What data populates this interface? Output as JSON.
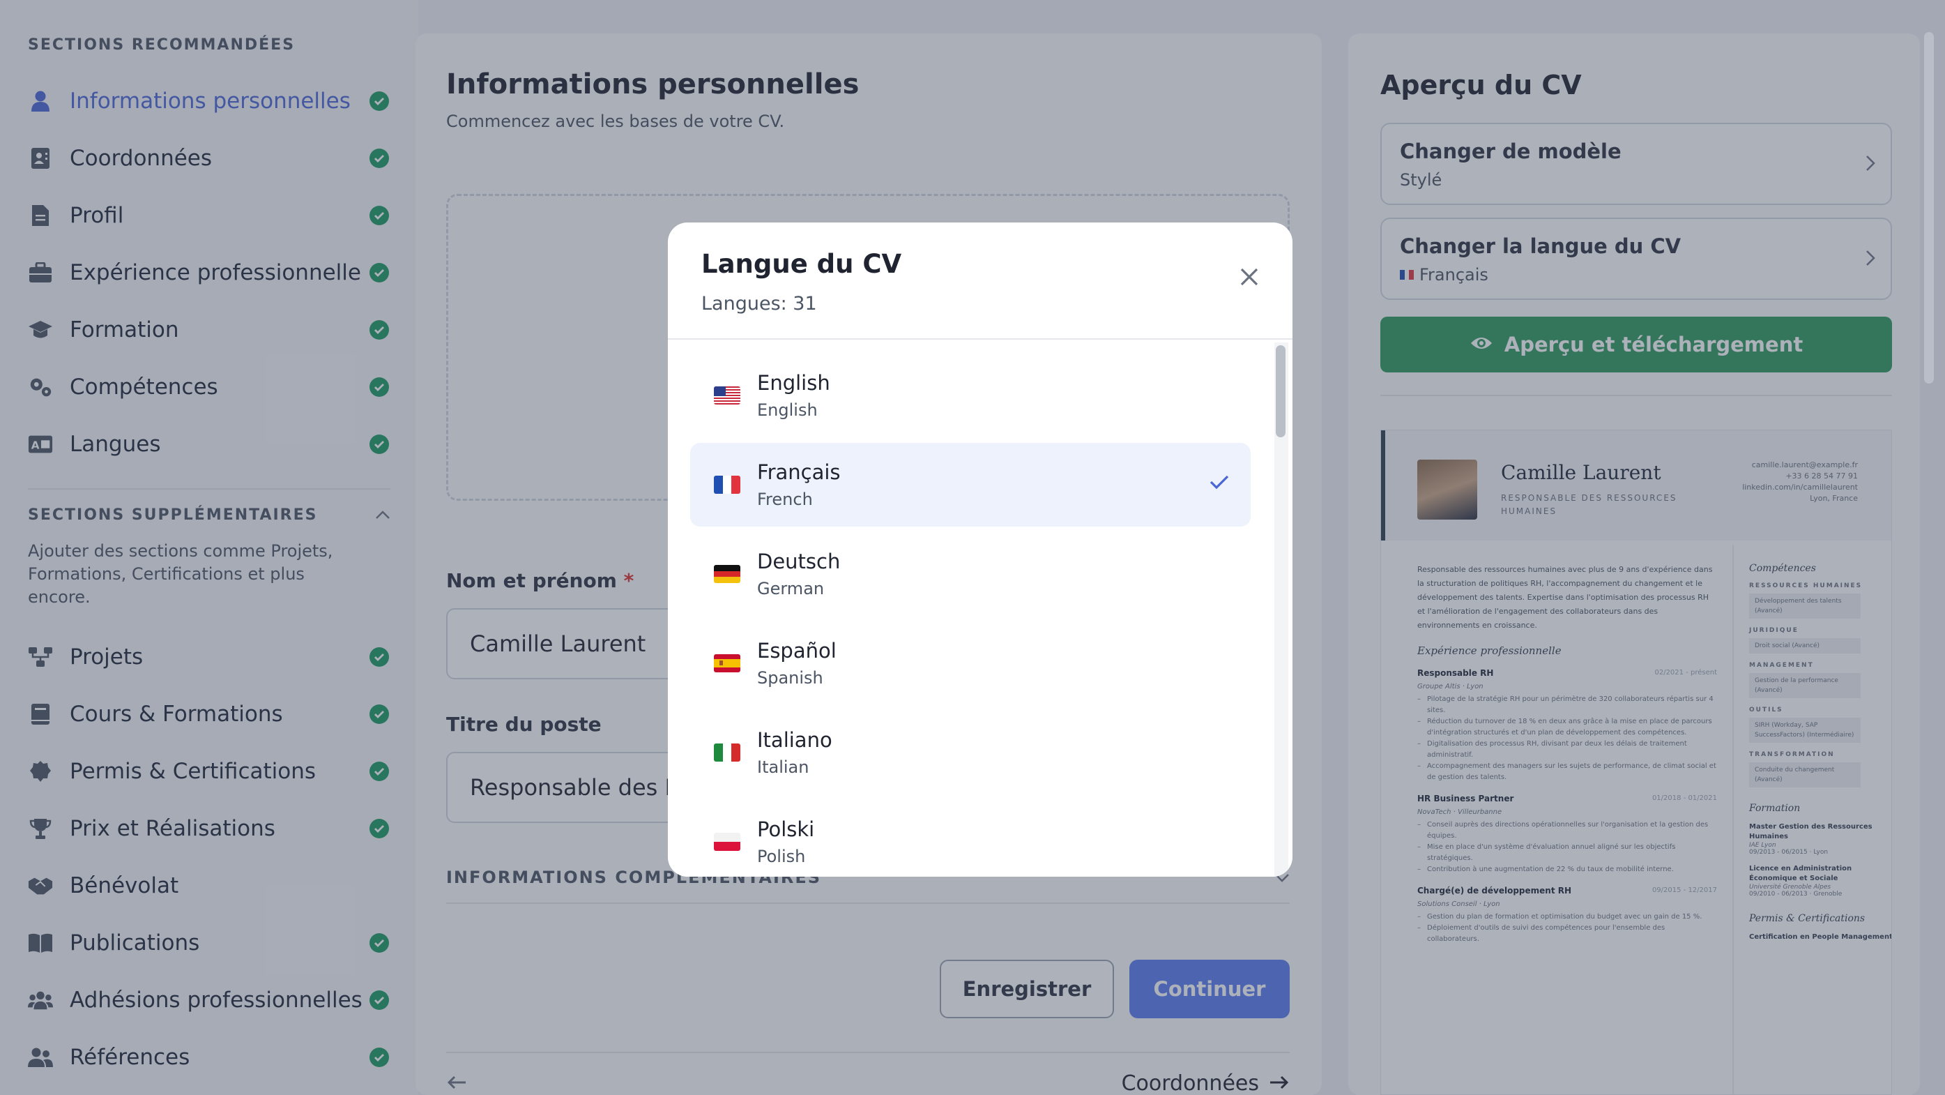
{
  "sidebar": {
    "recommended_heading": "SECTIONS RECOMMANDÉES",
    "recommended": [
      {
        "label": "Informations personnelles",
        "icon": "user-icon",
        "active": true,
        "done": true
      },
      {
        "label": "Coordonnées",
        "icon": "contact-card-icon",
        "done": true
      },
      {
        "label": "Profil",
        "icon": "document-icon",
        "done": true
      },
      {
        "label": "Expérience professionnelle",
        "icon": "briefcase-icon",
        "done": true
      },
      {
        "label": "Formation",
        "icon": "graduation-cap-icon",
        "done": true
      },
      {
        "label": "Compétences",
        "icon": "gears-icon",
        "done": true
      },
      {
        "label": "Langues",
        "icon": "language-icon",
        "done": true
      }
    ],
    "extra_heading": "SECTIONS SUPPLÉMENTAIRES",
    "extra_description": "Ajouter des sections comme Projets, Formations, Certifications et plus encore.",
    "extra": [
      {
        "label": "Projets",
        "icon": "project-icon",
        "done": true
      },
      {
        "label": "Cours & Formations",
        "icon": "book-icon",
        "done": true
      },
      {
        "label": "Permis & Certifications",
        "icon": "certificate-icon",
        "done": true
      },
      {
        "label": "Prix et Réalisations",
        "icon": "trophy-icon",
        "done": true
      },
      {
        "label": "Bénévolat",
        "icon": "handshake-icon",
        "done": false
      },
      {
        "label": "Publications",
        "icon": "open-book-icon",
        "done": true
      },
      {
        "label": "Adhésions professionnelles",
        "icon": "people-group-icon",
        "done": true
      },
      {
        "label": "Références",
        "icon": "users-icon",
        "done": true
      }
    ]
  },
  "main": {
    "title": "Informations personnelles",
    "subtitle": "Commencez avec les bases de votre CV.",
    "name_label": "Nom et prénom",
    "name_required": "*",
    "name_value": "Camille Laurent",
    "job_label": "Titre du poste",
    "job_value": "Responsable des Ressources Humaines",
    "extra_heading": "INFORMATIONS COMPLÉMENTAIRES",
    "save_label": "Enregistrer",
    "continue_label": "Continuer",
    "next_label": "Coordonnées"
  },
  "preview": {
    "title": "Aperçu du CV",
    "template_title": "Changer de modèle",
    "template_value": "Stylé",
    "language_title": "Changer la langue du CV",
    "language_value": "Français",
    "preview_button": "Aperçu et téléchargement"
  },
  "cv": {
    "name": "Camille Laurent",
    "role": "RESPONSABLE DES RESSOURCES HUMAINES",
    "email": "camille.laurent@example.fr",
    "phone": "+33 6 28 54 77 91",
    "linkedin": "linkedin.com/in/camillelaurent",
    "location": "Lyon, France",
    "summary": "Responsable des ressources humaines avec plus de 9 ans d'expérience dans la structuration de politiques RH, l'accompagnement du changement et le développement des talents. Expertise dans l'optimisation des processus RH et l'amélioration de l'engagement des collaborateurs dans des environnements en croissance.",
    "exp_heading": "Expérience professionnelle",
    "jobs": [
      {
        "title": "Responsable RH",
        "dates": "02/2021 - présent",
        "company": "Groupe Altis · Lyon",
        "bullets": [
          "Pilotage de la stratégie RH pour un périmètre de 320 collaborateurs répartis sur 4 sites.",
          "Réduction du turnover de 18 % en deux ans grâce à la mise en place de parcours d'intégration structurés et d'un plan de développement des compétences.",
          "Digitalisation des processus RH, divisant par deux les délais de traitement administratif.",
          "Accompagnement des managers sur les sujets de performance, de climat social et de gestion des talents."
        ]
      },
      {
        "title": "HR Business Partner",
        "dates": "01/2018 - 01/2021",
        "company": "NovaTech · Villeurbanne",
        "bullets": [
          "Conseil auprès des directions opérationnelles sur l'organisation et la gestion des équipes.",
          "Mise en place d'un système d'évaluation annuel aligné sur les objectifs stratégiques.",
          "Contribution à une augmentation de 22 % du taux de mobilité interne."
        ]
      },
      {
        "title": "Chargé(e) de développement RH",
        "dates": "09/2015 - 12/2017",
        "company": "Solutions Conseil · Lyon",
        "bullets": [
          "Gestion du plan de formation et optimisation du budget avec un gain de 15 %.",
          "Déploiement d'outils de suivi des compétences pour l'ensemble des collaborateurs."
        ]
      }
    ],
    "skills_heading": "Compétences",
    "skills": [
      {
        "category": "RESSOURCES HUMAINES",
        "tag": "Développement des talents (Avancé)"
      },
      {
        "category": "JURIDIQUE",
        "tag": "Droit social (Avancé)"
      },
      {
        "category": "MANAGEMENT",
        "tag": "Gestion de la performance (Avancé)"
      },
      {
        "category": "OUTILS",
        "tag": "SIRH (Workday, SAP SuccessFactors) (Intermédiaire)"
      },
      {
        "category": "TRANSFORMATION",
        "tag": "Conduite du changement (Avancé)"
      }
    ],
    "edu_heading": "Formation",
    "education": [
      {
        "degree": "Master Gestion des Ressources Humaines",
        "school": "IAE Lyon",
        "dates": "09/2013 - 06/2015 · Lyon"
      },
      {
        "degree": "Licence en Administration Économique et Sociale",
        "school": "Université Grenoble Alpes",
        "dates": "09/2010 - 06/2013 · Grenoble"
      }
    ],
    "cert_heading": "Permis & Certifications",
    "cert": "Certification en People Management"
  },
  "modal": {
    "title": "Langue du CV",
    "count": "Langues: 31",
    "languages": [
      {
        "name": "English",
        "english": "English",
        "flag": "us-flag-icon",
        "selected": false
      },
      {
        "name": "Français",
        "english": "French",
        "flag": "fr-flag-icon",
        "selected": true
      },
      {
        "name": "Deutsch",
        "english": "German",
        "flag": "de-flag-icon",
        "selected": false
      },
      {
        "name": "Español",
        "english": "Spanish",
        "flag": "es-flag-icon",
        "selected": false
      },
      {
        "name": "Italiano",
        "english": "Italian",
        "flag": "it-flag-icon",
        "selected": false
      },
      {
        "name": "Polski",
        "english": "Polish",
        "flag": "pl-flag-icon",
        "selected": false
      }
    ]
  },
  "colors": {
    "accent": "#5b7cf0",
    "active_nav": "#4a66d6",
    "success": "#1d9a63",
    "preview_button": "#2e9a5c",
    "selected_row": "#eef2fc"
  }
}
